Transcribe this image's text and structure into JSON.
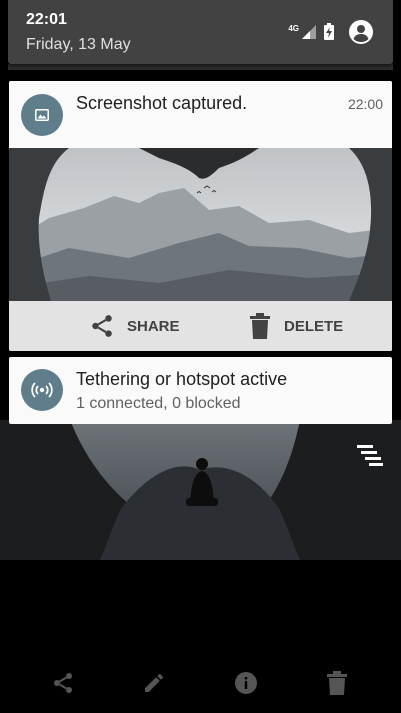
{
  "status": {
    "time": "22:01",
    "date": "Friday, 13 May",
    "network": "4G"
  },
  "notifications": {
    "screenshot": {
      "title": "Screenshot captured.",
      "time": "22:00",
      "icon": "image-icon",
      "actions": {
        "share": "SHARE",
        "delete": "DELETE"
      }
    },
    "hotspot": {
      "title": "Tethering or hotspot active",
      "subtitle": "1 connected, 0 blocked",
      "icon": "hotspot-icon"
    }
  },
  "bottom_bar": {
    "icons": [
      "share-icon",
      "edit-icon",
      "info-icon",
      "delete-icon"
    ]
  },
  "colors": {
    "header": "#424242",
    "card": "#fafafa",
    "app_icon": "#607d8b"
  }
}
